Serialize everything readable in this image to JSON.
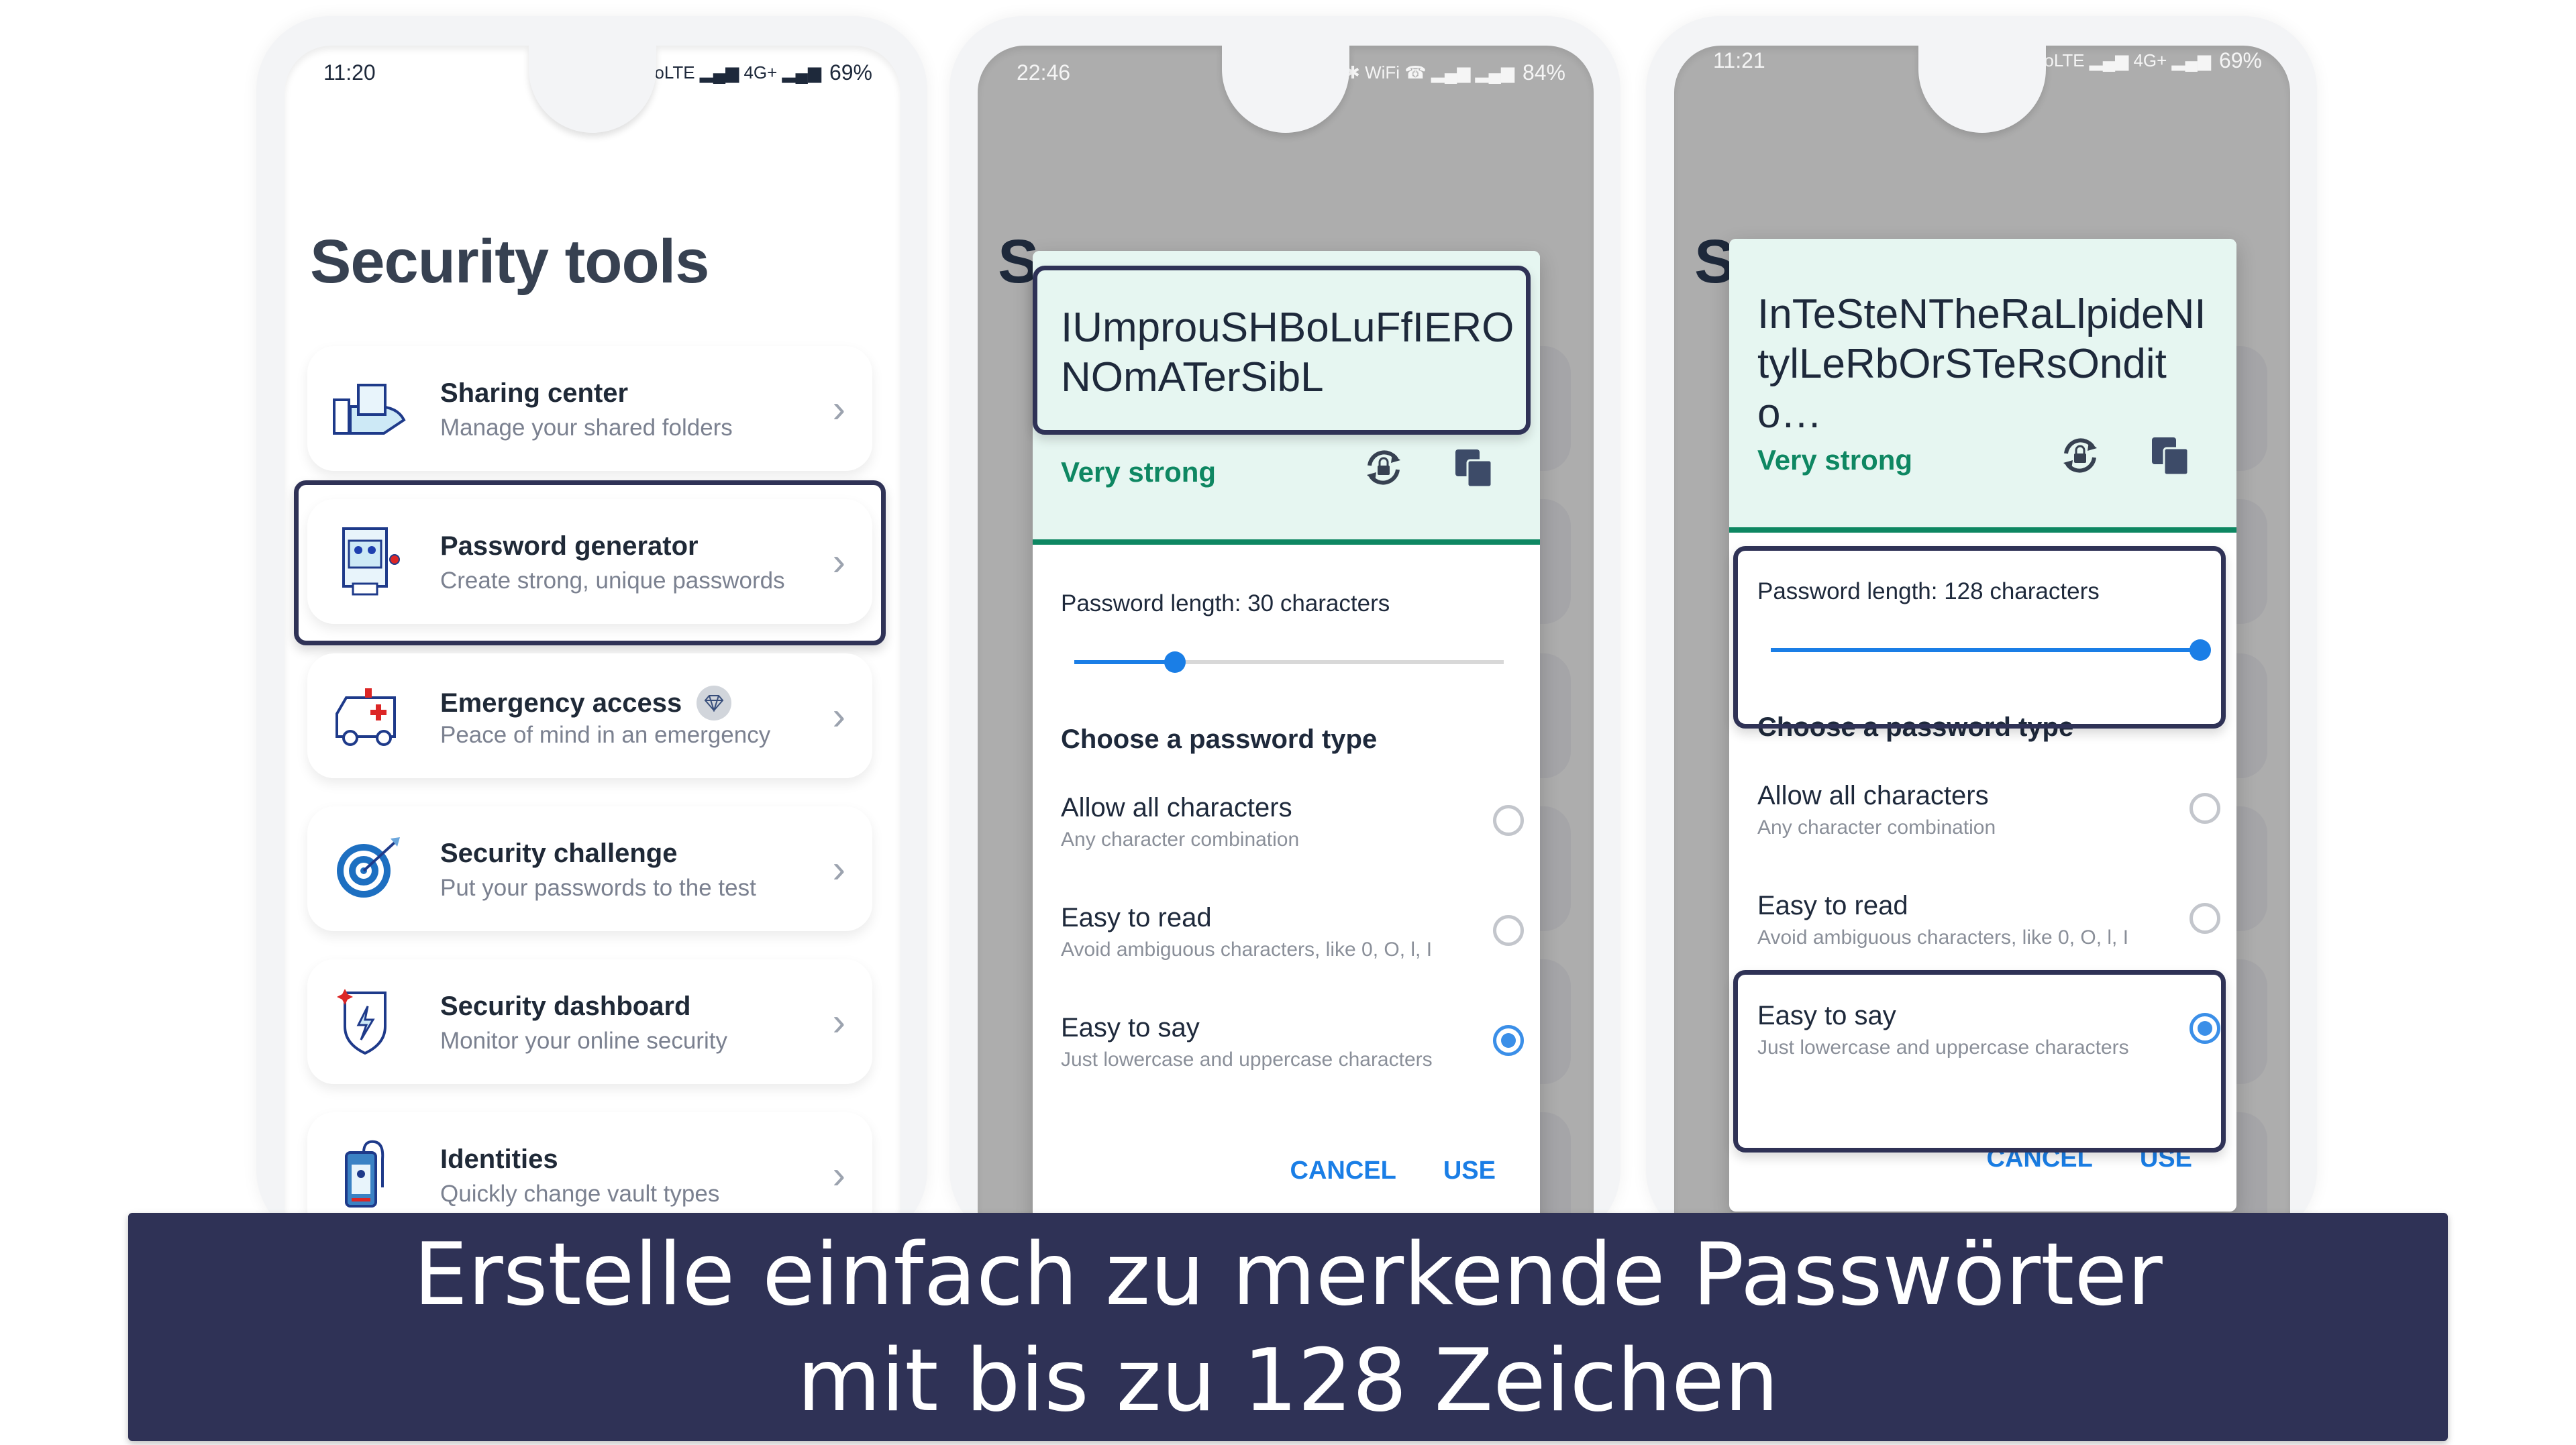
{
  "phone1": {
    "status": {
      "time": "11:20",
      "icons": "🔕 ✱ VoLTE ▂▄▆ 4G+ ▂▄▆",
      "battery": "69%"
    },
    "title": "Security tools",
    "tools": [
      {
        "title": "Sharing center",
        "subtitle": "Manage your shared folders",
        "icon": "sharing-hand-folder-icon"
      },
      {
        "title": "Password generator",
        "subtitle": "Create strong, unique passwords",
        "icon": "slot-machine-keys-icon",
        "highlighted": true
      },
      {
        "title": "Emergency access",
        "subtitle": "Peace of mind in an emergency",
        "icon": "ambulance-icon",
        "badge": "premium-diamond-icon"
      },
      {
        "title": "Security challenge",
        "subtitle": "Put your passwords to the test",
        "icon": "target-arrow-icon"
      },
      {
        "title": "Security dashboard",
        "subtitle": "Monitor your online security",
        "icon": "shield-bolt-icon"
      },
      {
        "title": "Identities",
        "subtitle": "Quickly change vault types",
        "icon": "id-badge-icon"
      }
    ]
  },
  "phone2": {
    "status": {
      "time": "22:46",
      "icons": "✉ 🔕 ✱ WiFi ☎ ▂▄▆ ▂▄▆",
      "battery": "84%"
    },
    "bg_title_initial": "S",
    "password": "IUmprouSHBoLuFfIERONOmATerSibL",
    "strength": "Very strong",
    "length_label": "Password length: 30 characters",
    "length_value": 30,
    "length_max": 128,
    "choose_label": "Choose a password type",
    "options": [
      {
        "title": "Allow all characters",
        "subtitle": "Any character combination",
        "selected": false
      },
      {
        "title": "Easy to read",
        "subtitle": "Avoid ambiguous characters, like 0, O, l, I",
        "selected": false
      },
      {
        "title": "Easy to say",
        "subtitle": "Just lowercase and uppercase characters",
        "selected": true
      }
    ],
    "cancel": "CANCEL",
    "use": "USE"
  },
  "phone3": {
    "status": {
      "time": "11:21",
      "icons": "🔕 ✱ VoLTE ▂▄▆ 4G+ ▂▄▆",
      "battery": "69%"
    },
    "bg_title_initial": "S",
    "password": "InTeSteNTheRaLlpideNItylLeRbOrSTeRsOndito…",
    "strength": "Very strong",
    "length_label": "Password length: 128 characters",
    "length_value": 128,
    "length_max": 128,
    "choose_label": "Choose a password type",
    "options": [
      {
        "title": "Allow all characters",
        "subtitle": "Any character combination",
        "selected": false
      },
      {
        "title": "Easy to read",
        "subtitle": "Avoid ambiguous characters, like 0, O, l, I",
        "selected": false
      },
      {
        "title": "Easy to say",
        "subtitle": "Just lowercase and uppercase characters",
        "selected": true
      }
    ],
    "cancel": "CANCEL",
    "use": "USE"
  },
  "caption": {
    "line1": "Erstelle einfach zu merkende Passwörter",
    "line2": "mit bis zu 128 Zeichen"
  },
  "colors": {
    "accent_blue": "#1a7ee6",
    "strength_green": "#0e8762",
    "highlight_navy": "#2f3256",
    "dialog_header_bg": "#e6f6f1"
  }
}
